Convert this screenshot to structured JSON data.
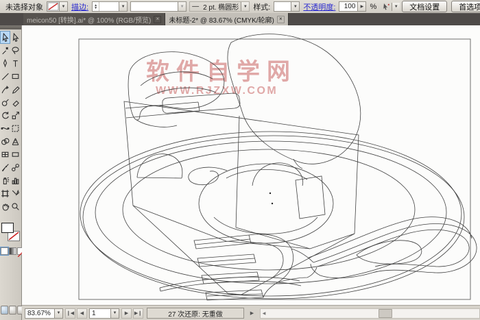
{
  "control_bar": {
    "selection_status": "未选择对象",
    "stroke_label": "描边:",
    "brush_dash": "—",
    "brush_value": "2 pt. 椭圆形",
    "style_label": "样式:",
    "opacity_label": "不透明度:",
    "opacity_value": "100",
    "percent_label": "%",
    "document_setup_button": "文档设置",
    "preferences_button": "首选项"
  },
  "tabs": [
    {
      "label": "meicon50 [转换].ai* @ 100% (RGB/预览)",
      "close": "×",
      "active": false
    },
    {
      "label": "未标题-2* @ 83.67% (CMYK/轮廓)",
      "close": "×",
      "active": true
    }
  ],
  "toolbar": {
    "tools": [
      "selection",
      "direct-selection",
      "magic-wand",
      "lasso",
      "pen",
      "type",
      "line-segment",
      "rectangle",
      "paintbrush",
      "pencil",
      "blob-brush",
      "eraser",
      "rotate",
      "scale",
      "width-tool",
      "free-transform",
      "shape-builder",
      "perspective-grid",
      "mesh",
      "gradient",
      "eyedropper",
      "blend",
      "symbol-sprayer",
      "column-graph",
      "artboard",
      "slice",
      "hand",
      "zoom"
    ],
    "selected_tool": "selection"
  },
  "canvas": {
    "watermark_title": "软件自学网",
    "watermark_url": "WWW.RJZXW.COM",
    "artwork_subject": "wireframe outline drawing of cake slice with strawberry and fork on plate"
  },
  "status_bar": {
    "zoom_value": "83.67%",
    "first_button": "❙◀",
    "prev_button": "◀",
    "artboard_number": "1",
    "next_button": "▶",
    "last_button": "▶❙",
    "undo_status": "27 次还原: 无重做",
    "flyout_button": "▶",
    "scroll_left_arrow": "◀"
  },
  "colors": {
    "selected_tool_highlight": "#b9d8f4",
    "watermark_red": "#c45454",
    "link_blue": "#2a2ad0",
    "tab_bar_dark": "#4e4a48",
    "active_tab": "#c3bfb8"
  }
}
